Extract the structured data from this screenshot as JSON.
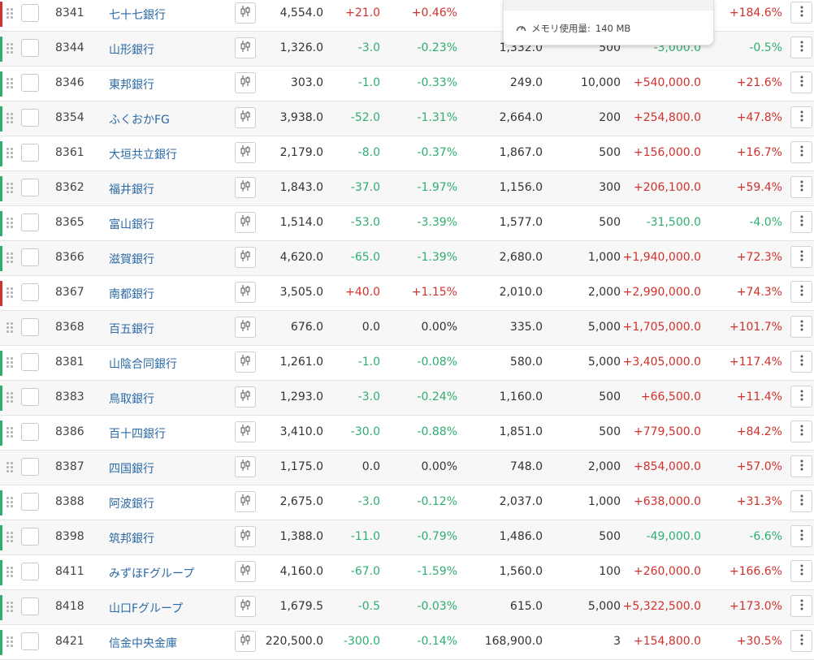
{
  "popup": {
    "memory_label": "メモリ使用量:",
    "memory_value": "140 MB"
  },
  "icons": {
    "drag_handle": "drag-handle-icon",
    "chart": "candlestick-chart-icon",
    "menu": "more-vertical-icon",
    "memory": "gauge-icon"
  },
  "colors": {
    "up": "#d0312d",
    "down": "#2fae6f",
    "flat": "#333333",
    "link": "#2b6aa6"
  },
  "columns": [
    "code",
    "name",
    "price",
    "change",
    "change_pct",
    "buy_price",
    "quantity",
    "profit_loss",
    "profit_loss_pct"
  ],
  "rows": [
    {
      "code": "8341",
      "name": "七十七銀行",
      "price": "4,554.0",
      "change": "+21.0",
      "change_pct": "+0.46%",
      "buy_price": "",
      "quantity": "",
      "profit_loss": "",
      "profit_loss_pct": "+184.6%",
      "dir": "up",
      "pl_dir": "up"
    },
    {
      "code": "8344",
      "name": "山形銀行",
      "price": "1,326.0",
      "change": "-3.0",
      "change_pct": "-0.23%",
      "buy_price": "1,332.0",
      "quantity": "500",
      "profit_loss": "-3,000.0",
      "profit_loss_pct": "-0.5%",
      "dir": "down",
      "pl_dir": "down"
    },
    {
      "code": "8346",
      "name": "東邦銀行",
      "price": "303.0",
      "change": "-1.0",
      "change_pct": "-0.33%",
      "buy_price": "249.0",
      "quantity": "10,000",
      "profit_loss": "+540,000.0",
      "profit_loss_pct": "+21.6%",
      "dir": "down",
      "pl_dir": "up"
    },
    {
      "code": "8354",
      "name": "ふくおかFG",
      "price": "3,938.0",
      "change": "-52.0",
      "change_pct": "-1.31%",
      "buy_price": "2,664.0",
      "quantity": "200",
      "profit_loss": "+254,800.0",
      "profit_loss_pct": "+47.8%",
      "dir": "down",
      "pl_dir": "up"
    },
    {
      "code": "8361",
      "name": "大垣共立銀行",
      "price": "2,179.0",
      "change": "-8.0",
      "change_pct": "-0.37%",
      "buy_price": "1,867.0",
      "quantity": "500",
      "profit_loss": "+156,000.0",
      "profit_loss_pct": "+16.7%",
      "dir": "down",
      "pl_dir": "up"
    },
    {
      "code": "8362",
      "name": "福井銀行",
      "price": "1,843.0",
      "change": "-37.0",
      "change_pct": "-1.97%",
      "buy_price": "1,156.0",
      "quantity": "300",
      "profit_loss": "+206,100.0",
      "profit_loss_pct": "+59.4%",
      "dir": "down",
      "pl_dir": "up"
    },
    {
      "code": "8365",
      "name": "富山銀行",
      "price": "1,514.0",
      "change": "-53.0",
      "change_pct": "-3.39%",
      "buy_price": "1,577.0",
      "quantity": "500",
      "profit_loss": "-31,500.0",
      "profit_loss_pct": "-4.0%",
      "dir": "down",
      "pl_dir": "down"
    },
    {
      "code": "8366",
      "name": "滋賀銀行",
      "price": "4,620.0",
      "change": "-65.0",
      "change_pct": "-1.39%",
      "buy_price": "2,680.0",
      "quantity": "1,000",
      "profit_loss": "+1,940,000.0",
      "profit_loss_pct": "+72.3%",
      "dir": "down",
      "pl_dir": "up"
    },
    {
      "code": "8367",
      "name": "南都銀行",
      "price": "3,505.0",
      "change": "+40.0",
      "change_pct": "+1.15%",
      "buy_price": "2,010.0",
      "quantity": "2,000",
      "profit_loss": "+2,990,000.0",
      "profit_loss_pct": "+74.3%",
      "dir": "up",
      "pl_dir": "up"
    },
    {
      "code": "8368",
      "name": "百五銀行",
      "price": "676.0",
      "change": "0.0",
      "change_pct": "0.00%",
      "buy_price": "335.0",
      "quantity": "5,000",
      "profit_loss": "+1,705,000.0",
      "profit_loss_pct": "+101.7%",
      "dir": "flat",
      "pl_dir": "up"
    },
    {
      "code": "8381",
      "name": "山陰合同銀行",
      "price": "1,261.0",
      "change": "-1.0",
      "change_pct": "-0.08%",
      "buy_price": "580.0",
      "quantity": "5,000",
      "profit_loss": "+3,405,000.0",
      "profit_loss_pct": "+117.4%",
      "dir": "down",
      "pl_dir": "up"
    },
    {
      "code": "8383",
      "name": "鳥取銀行",
      "price": "1,293.0",
      "change": "-3.0",
      "change_pct": "-0.24%",
      "buy_price": "1,160.0",
      "quantity": "500",
      "profit_loss": "+66,500.0",
      "profit_loss_pct": "+11.4%",
      "dir": "down",
      "pl_dir": "up"
    },
    {
      "code": "8386",
      "name": "百十四銀行",
      "price": "3,410.0",
      "change": "-30.0",
      "change_pct": "-0.88%",
      "buy_price": "1,851.0",
      "quantity": "500",
      "profit_loss": "+779,500.0",
      "profit_loss_pct": "+84.2%",
      "dir": "down",
      "pl_dir": "up"
    },
    {
      "code": "8387",
      "name": "四国銀行",
      "price": "1,175.0",
      "change": "0.0",
      "change_pct": "0.00%",
      "buy_price": "748.0",
      "quantity": "2,000",
      "profit_loss": "+854,000.0",
      "profit_loss_pct": "+57.0%",
      "dir": "flat",
      "pl_dir": "up"
    },
    {
      "code": "8388",
      "name": "阿波銀行",
      "price": "2,675.0",
      "change": "-3.0",
      "change_pct": "-0.12%",
      "buy_price": "2,037.0",
      "quantity": "1,000",
      "profit_loss": "+638,000.0",
      "profit_loss_pct": "+31.3%",
      "dir": "down",
      "pl_dir": "up"
    },
    {
      "code": "8398",
      "name": "筑邦銀行",
      "price": "1,388.0",
      "change": "-11.0",
      "change_pct": "-0.79%",
      "buy_price": "1,486.0",
      "quantity": "500",
      "profit_loss": "-49,000.0",
      "profit_loss_pct": "-6.6%",
      "dir": "down",
      "pl_dir": "down"
    },
    {
      "code": "8411",
      "name": "みずほFグループ",
      "price": "4,160.0",
      "change": "-67.0",
      "change_pct": "-1.59%",
      "buy_price": "1,560.0",
      "quantity": "100",
      "profit_loss": "+260,000.0",
      "profit_loss_pct": "+166.6%",
      "dir": "down",
      "pl_dir": "up"
    },
    {
      "code": "8418",
      "name": "山口Fグループ",
      "price": "1,679.5",
      "change": "-0.5",
      "change_pct": "-0.03%",
      "buy_price": "615.0",
      "quantity": "5,000",
      "profit_loss": "+5,322,500.0",
      "profit_loss_pct": "+173.0%",
      "dir": "down",
      "pl_dir": "up"
    },
    {
      "code": "8421",
      "name": "信金中央金庫",
      "price": "220,500.0",
      "change": "-300.0",
      "change_pct": "-0.14%",
      "buy_price": "168,900.0",
      "quantity": "3",
      "profit_loss": "+154,800.0",
      "profit_loss_pct": "+30.5%",
      "dir": "down",
      "pl_dir": "up"
    }
  ]
}
